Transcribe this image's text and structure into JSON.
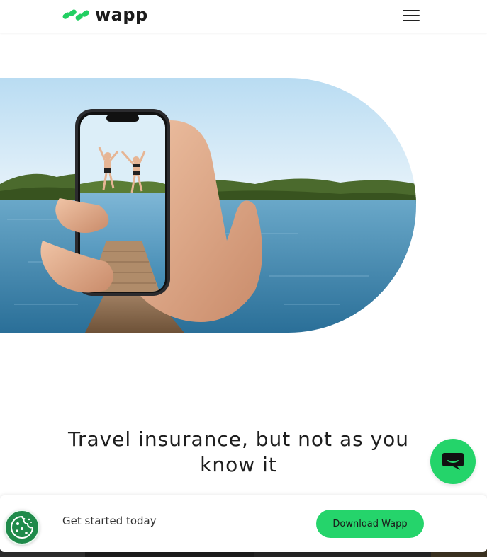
{
  "header": {
    "logo_text": "wapp",
    "logo_icon": "wapp-logo-icon",
    "menu_icon": "hamburger-menu-icon"
  },
  "hero": {
    "image_description_icon": "phone-photo-image"
  },
  "main": {
    "headline_line1": "Travel insurance, but not as you",
    "headline_line2": "know it"
  },
  "cta": {
    "text": "Get started today",
    "button_label": "Download Wapp"
  },
  "widgets": {
    "chat_icon": "chat-bubble-icon",
    "cookie_icon": "cookie-icon"
  },
  "colors": {
    "brand_green": "#25d46b",
    "cookie_green": "#1f8a4a"
  }
}
